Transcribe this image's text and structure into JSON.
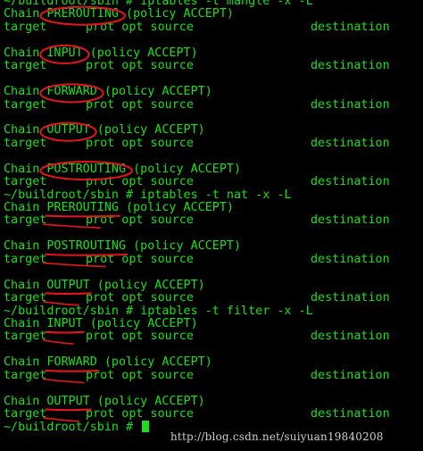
{
  "terminal": {
    "colors": {
      "background": "#000000",
      "text": "#19e019",
      "annotation": "#e8141c",
      "watermark": "#cfcfcf"
    },
    "top_partial_line": {
      "left": "~/buildroot/sbin # iptables -t mangle -x -L",
      "right": "destination"
    },
    "header": {
      "target": "target",
      "prot_opt_source": "prot opt source",
      "destination": "destination"
    },
    "blocks": [
      {
        "command": "~/buildroot/sbin # iptables -t mangle -x -L",
        "chains": [
          {
            "prefix": "Chain ",
            "name": "PREROUTING",
            "policy": " (policy ACCEPT)"
          },
          {
            "prefix": "Chain ",
            "name": "INPUT",
            "policy": " (policy ACCEPT)"
          },
          {
            "prefix": "Chain ",
            "name": "FORWARD",
            "policy": " (policy ACCEPT)"
          },
          {
            "prefix": "Chain ",
            "name": "OUTPUT",
            "policy": " (policy ACCEPT)"
          },
          {
            "prefix": "Chain ",
            "name": "POSTROUTING",
            "policy": " (policy ACCEPT)"
          }
        ]
      },
      {
        "command": "~/buildroot/sbin # iptables -t nat -x -L",
        "chains": [
          {
            "prefix": "Chain ",
            "name": "PREROUTING",
            "policy": " (policy ACCEPT)"
          },
          {
            "prefix": "Chain ",
            "name": "POSTROUTING",
            "policy": " (policy ACCEPT)"
          },
          {
            "prefix": "Chain ",
            "name": "OUTPUT",
            "policy": " (policy ACCEPT)"
          }
        ]
      },
      {
        "command": "~/buildroot/sbin # iptables -t filter -x -L",
        "chains": [
          {
            "prefix": "Chain ",
            "name": "INPUT",
            "policy": " (policy ACCEPT)"
          },
          {
            "prefix": "Chain ",
            "name": "FORWARD",
            "policy": " (policy ACCEPT)"
          },
          {
            "prefix": "Chain ",
            "name": "OUTPUT",
            "policy": " (policy ACCEPT)"
          }
        ]
      }
    ],
    "final_prompt": "~/buildroot/sbin # ",
    "watermark": "http://blog.csdn.net/suiyuan19840208"
  }
}
